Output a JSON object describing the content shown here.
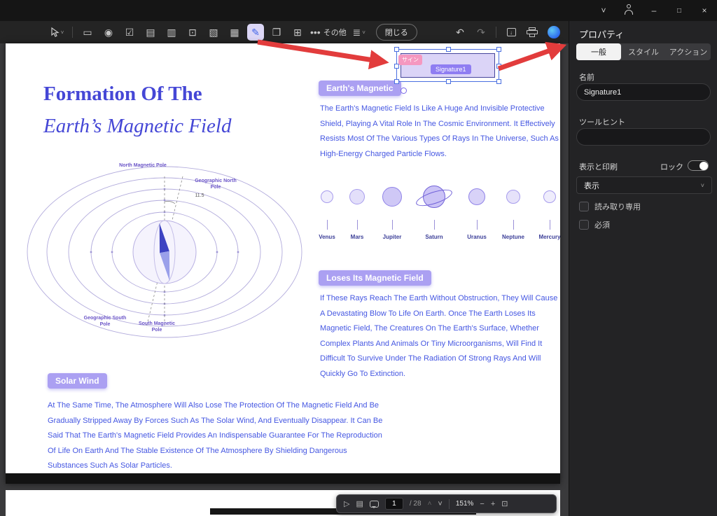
{
  "titlebar": {
    "chevron": "˅",
    "minimize": "–",
    "maximize": "□",
    "close": "×"
  },
  "toolbar": {
    "icons": {
      "caret": "˅",
      "button": "▭",
      "radio": "◉",
      "checkbox": "☑",
      "combo": "▤",
      "list": "▥",
      "text_field": "⊡",
      "image_field": "▧",
      "date_field": "▦",
      "signature_pen": "✎",
      "stamp": "❐",
      "grid": "⊞",
      "align": "≣",
      "undo": "↶",
      "redo": "↷",
      "export_arrow": "↓"
    },
    "more_dots": "•••",
    "more_label": "その他",
    "close_label": "閉じる"
  },
  "panel": {
    "title": "プロパティ",
    "tabs": [
      {
        "label": "一般"
      },
      {
        "label": "スタイル"
      },
      {
        "label": "アクション"
      }
    ],
    "name_label": "名前",
    "name_value": "Signature1",
    "tooltip_label": "ツールヒント",
    "tooltip_value": "",
    "display_print_label": "表示と印刷",
    "lock_label": "ロック",
    "display_value": "表示",
    "select_caret": "˅",
    "readonly_label": "読み取り専用",
    "required_label": "必須"
  },
  "document": {
    "title_line1": "Formation Of The",
    "title_line2": "Earth’s Magnetic Field",
    "signature": {
      "tag": "サイン",
      "name": "Signature1"
    },
    "sections": [
      {
        "badge": "Earth's Magnetic",
        "text": "The Earth's Magnetic Field Is Like A Huge And Invisible Protective Shield, Playing A Vital Role In The Cosmic Environment. It Effectively Resists Most Of The Various Types Of Rays In The Universe, Such As High-Energy Charged Particle Flows."
      },
      {
        "badge": "Loses Its Magnetic Field",
        "text": "If These Rays Reach The Earth Without Obstruction, They Will Cause A Devastating Blow To Life On Earth. Once The Earth Loses Its Magnetic Field, The Creatures On The Earth's Surface, Whether Complex Plants And Animals Or Tiny Microorganisms, Will Find It Difficult To Survive Under The Radiation Of Strong Rays And Will Quickly Go To Extinction."
      },
      {
        "badge": "Solar Wind",
        "text": "At The Same Time, The Atmosphere Will Also Lose The Protection Of The Magnetic Field And Be Gradually Stripped Away By Forces Such As The Solar Wind, And Eventually Disappear. It Can Be Said That The Earth's Magnetic Field Provides An Indispensable Guarantee For The Reproduction Of Life On Earth And The Stable Existence Of The Atmosphere By Shielding Dangerous Substances Such As Solar Particles."
      }
    ],
    "planets": [
      "Venus",
      "Mars",
      "Jupiter",
      "Saturn",
      "Uranus",
      "Neptune",
      "Mercury"
    ],
    "diagram": {
      "north_magnetic": "North Magnetic Pole",
      "geographic_north": "Geographic North Pole",
      "angle": "11.5",
      "geographic_south": "Geographic South Pole",
      "south_magnetic": "South Magnetic Pole"
    }
  },
  "bottom_bar": {
    "play": "▷",
    "panel_icon": "▤",
    "page_value": "1",
    "page_total": "/ 28",
    "chevron_up": "˄",
    "chevron_down": "˅",
    "zoom": "151%",
    "minus": "−",
    "plus": "+",
    "fit": "⊡"
  }
}
